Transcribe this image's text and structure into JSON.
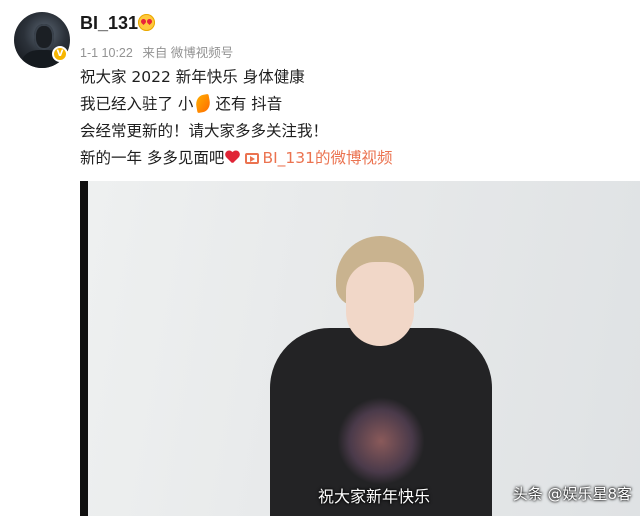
{
  "user": {
    "name": "BI_131",
    "name_emoji": "heart-eyes-emoji"
  },
  "meta": {
    "time": "1-1 10:22",
    "source": "来自 微博视频号"
  },
  "post": {
    "line1": "祝大家 2022 新年快乐 身体健康",
    "line2_a": "我已经入驻了 小",
    "line2_b": " 还有 抖音",
    "line3": "会经常更新的！请大家多多关注我！",
    "line4_a": "新的一年 多多见面吧",
    "video_link": "BI_131的微博视频"
  },
  "video": {
    "caption": "祝大家新年快乐",
    "watermark": "头条 @娱乐星8客"
  },
  "colors": {
    "link": "#eb7350",
    "verified": "#f7b500",
    "meta": "#939393"
  }
}
